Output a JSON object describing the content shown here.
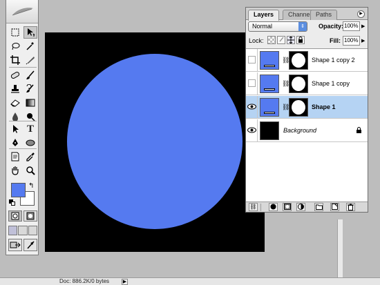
{
  "document": {
    "status_text": "Doc: 886.2K/0 bytes",
    "canvas_color": "#000000",
    "circle_color": "#557af0"
  },
  "toolbox": {
    "foreground_color": "#557af0",
    "background_color": "#ffffff",
    "tools": [
      "marquee-tool",
      "move-tool",
      "lasso-tool",
      "magic-wand-tool",
      "crop-tool",
      "slice-tool",
      "healing-brush-tool",
      "brush-tool",
      "clone-stamp-tool",
      "history-brush-tool",
      "eraser-tool",
      "gradient-tool",
      "blur-tool",
      "dodge-tool",
      "path-selection-tool",
      "type-tool",
      "pen-tool",
      "shape-tool",
      "notes-tool",
      "eyedropper-tool",
      "hand-tool",
      "zoom-tool"
    ],
    "type_tool_glyph": "T"
  },
  "layers_palette": {
    "tabs": [
      {
        "label": "Layers",
        "active": true
      },
      {
        "label": "Channels",
        "active": false
      },
      {
        "label": "Paths",
        "active": false
      }
    ],
    "blend_mode": "Normal",
    "opacity_label": "Opacity:",
    "opacity_value": "100%",
    "lock_label": "Lock:",
    "fill_label": "Fill:",
    "fill_value": "100%",
    "layers": [
      {
        "name": "Shape 1 copy 2",
        "visible": false,
        "selected": false,
        "type": "shape"
      },
      {
        "name": "Shape 1 copy",
        "visible": false,
        "selected": false,
        "type": "shape"
      },
      {
        "name": "Shape 1",
        "visible": true,
        "selected": true,
        "type": "shape"
      },
      {
        "name": "Background",
        "visible": true,
        "selected": false,
        "type": "background",
        "locked": true
      }
    ],
    "selection_color": "#b5d3f3"
  }
}
